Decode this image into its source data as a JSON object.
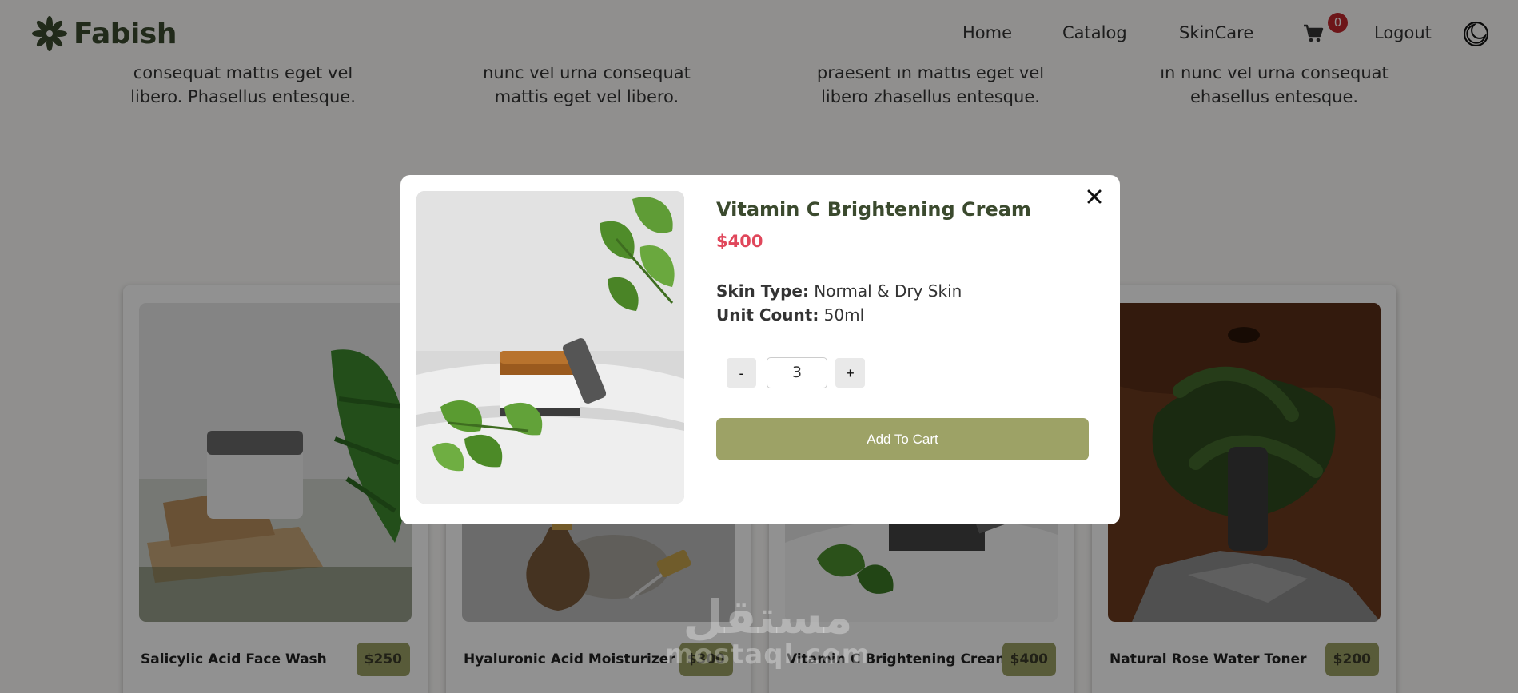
{
  "header": {
    "brand": "Fabish",
    "nav": {
      "home": "Home",
      "catalog": "Catalog",
      "skincare": "SkinCare",
      "logout": "Logout"
    },
    "cart_count": "0"
  },
  "features": [
    {
      "text": "consequat mattis eget vel libero. Phasellus entesque."
    },
    {
      "text": "nunc vel urna consequat mattis eget vel libero."
    },
    {
      "text": "praesent in mattis eget vel libero zhasellus entesque."
    },
    {
      "text": "in nunc vel urna consequat ehasellus entesque."
    }
  ],
  "products": [
    {
      "name": "Salicylic Acid Face Wash",
      "price": "$250"
    },
    {
      "name": "Hyaluronic Acid Moisturizer",
      "price": "$300"
    },
    {
      "name": "Vitamin C Brightening Cream",
      "price": "$400"
    },
    {
      "name": "Natural Rose Water Toner",
      "price": "$200"
    }
  ],
  "modal": {
    "title": "Vitamin C Brightening Cream",
    "price": "$400",
    "skin_type_label": "Skin Type:",
    "skin_type_value": " Normal & Dry Skin",
    "unit_count_label": "Unit Count:",
    "unit_count_value": " 50ml",
    "minus_label": "-",
    "plus_label": "+",
    "quantity": "3",
    "add_to_cart_label": "Add To Cart"
  },
  "watermark": {
    "arabic": "مستقل",
    "latin": "mostaql.com"
  },
  "colors": {
    "brand_green": "#3b4a2e",
    "accent_olive": "#9da266",
    "price_red": "#e0475b",
    "badge_red": "#c0282d"
  }
}
